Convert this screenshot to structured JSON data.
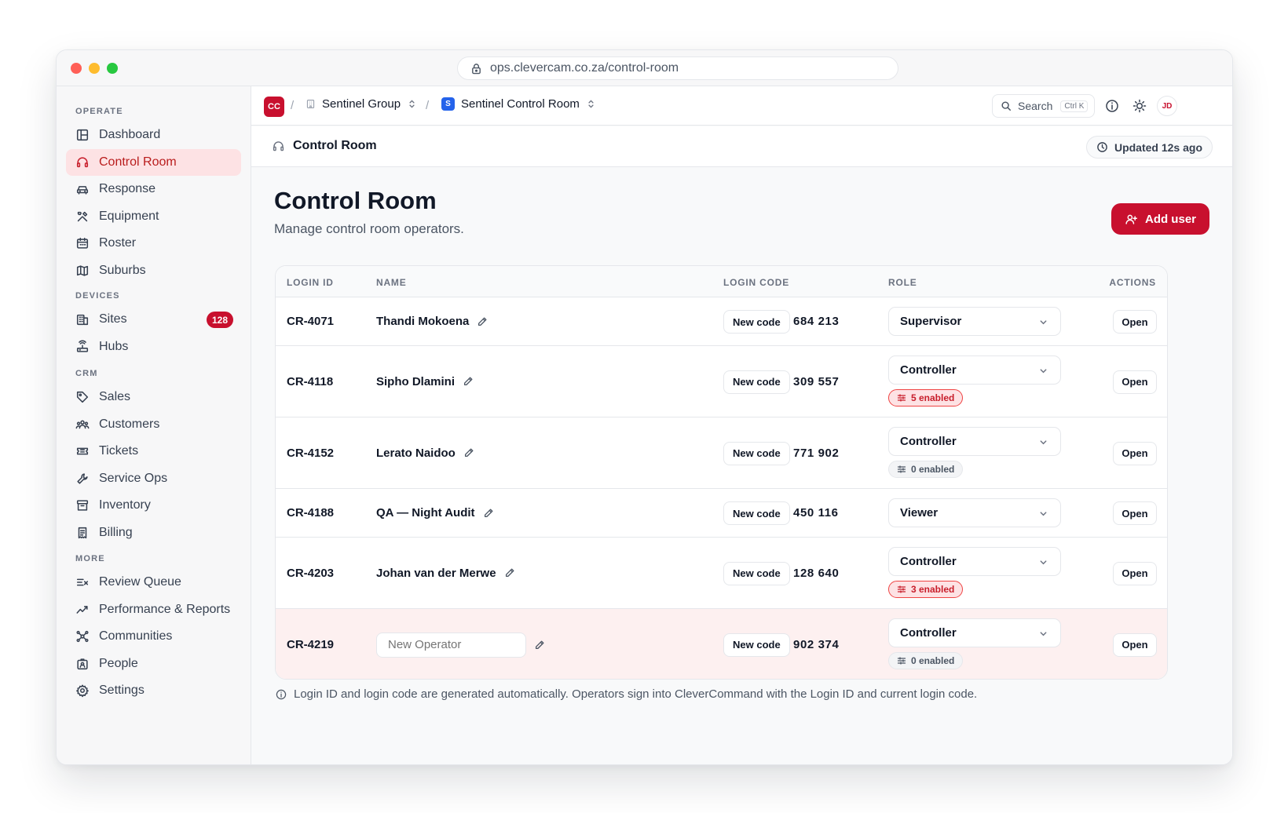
{
  "browser": {
    "url": "ops.clevercam.co.za/control-room"
  },
  "sidebar": {
    "sections": [
      {
        "label": "OPERATE",
        "items": [
          {
            "label": "Dashboard",
            "icon": "layout-icon"
          },
          {
            "label": "Control Room",
            "icon": "headset-icon",
            "active": true
          },
          {
            "label": "Response",
            "icon": "car-icon"
          },
          {
            "label": "Equipment",
            "icon": "tools-icon"
          },
          {
            "label": "Roster",
            "icon": "calendar-icon"
          },
          {
            "label": "Suburbs",
            "icon": "map-icon"
          }
        ]
      },
      {
        "label": "DEVICES",
        "items": [
          {
            "label": "Sites",
            "icon": "building-icon",
            "badge": "128"
          },
          {
            "label": "Hubs",
            "icon": "router-icon"
          }
        ]
      },
      {
        "label": "CRM",
        "items": [
          {
            "label": "Sales",
            "icon": "tag-icon"
          },
          {
            "label": "Customers",
            "icon": "users-icon"
          },
          {
            "label": "Tickets",
            "icon": "ticket-icon"
          },
          {
            "label": "Service Ops",
            "icon": "wrench-icon"
          },
          {
            "label": "Inventory",
            "icon": "archive-icon"
          },
          {
            "label": "Billing",
            "icon": "receipt-icon"
          }
        ]
      },
      {
        "label": "MORE",
        "items": [
          {
            "label": "Review Queue",
            "icon": "list-check-icon"
          },
          {
            "label": "Performance & Reports",
            "icon": "trend-icon"
          },
          {
            "label": "Communities",
            "icon": "network-icon"
          },
          {
            "label": "People",
            "icon": "id-badge-icon"
          },
          {
            "label": "Settings",
            "icon": "gear-icon"
          }
        ]
      }
    ]
  },
  "topnav": {
    "logo": "CC",
    "separator": "/",
    "org": "Sentinel Group",
    "workspace_initial": "S",
    "workspace": "Sentinel Control Room",
    "search_label": "Search",
    "search_shortcut": "Ctrl K",
    "avatar": "JD"
  },
  "subheader": {
    "title": "Control Room",
    "updated": "Updated 12s ago"
  },
  "page": {
    "title": "Control Room",
    "subtitle": "Manage control room operators.",
    "add_user_label": "Add user"
  },
  "table": {
    "columns": [
      "LOGIN ID",
      "NAME",
      "LOGIN CODE",
      "ROLE",
      "ACTIONS"
    ],
    "new_code_label": "New code",
    "open_label": "Open",
    "rows": [
      {
        "login_id": "CR-4071",
        "name": "Thandi Mokoena",
        "code": "684 213",
        "role": "Supervisor",
        "perm": null
      },
      {
        "login_id": "CR-4118",
        "name": "Sipho Dlamini",
        "code": "309 557",
        "role": "Controller",
        "perm": "5 enabled",
        "perm_style": "red"
      },
      {
        "login_id": "CR-4152",
        "name": "Lerato Naidoo",
        "code": "771 902",
        "role": "Controller",
        "perm": "0 enabled",
        "perm_style": "grey"
      },
      {
        "login_id": "CR-4188",
        "name": "QA — Night Audit",
        "code": "450 116",
        "role": "Viewer",
        "perm": null
      },
      {
        "login_id": "CR-4203",
        "name": "Johan van der Merwe",
        "code": "128 640",
        "role": "Controller",
        "perm": "3 enabled",
        "perm_style": "red"
      },
      {
        "login_id": "CR-4219",
        "name": "",
        "name_placeholder": "New Operator",
        "code": "902 374",
        "role": "Controller",
        "perm": "0 enabled",
        "perm_style": "grey",
        "editing": true
      }
    ]
  },
  "footnote": "Login ID and login code are generated automatically. Operators sign into CleverCommand with the Login ID and current login code.",
  "colors": {
    "brand": "#c8102e",
    "active_bg": "#fde2e4",
    "workspace_blue": "#2563eb"
  }
}
